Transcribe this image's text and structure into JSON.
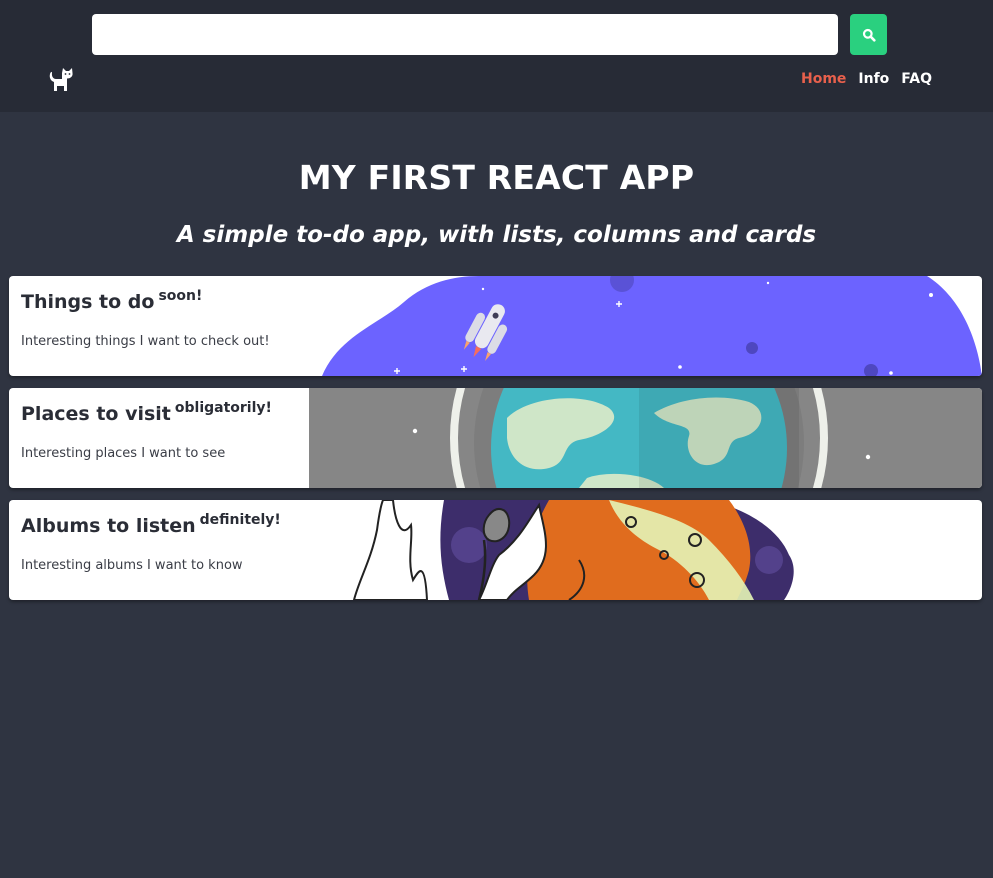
{
  "header": {
    "search": {
      "value": "",
      "placeholder": ""
    },
    "search_button_icon": "search-icon",
    "logo_icon": "cat-icon",
    "nav": [
      {
        "label": "Home",
        "active": true
      },
      {
        "label": "Info",
        "active": false
      },
      {
        "label": "FAQ",
        "active": false
      }
    ]
  },
  "hero": {
    "title": "MY FIRST REACT APP",
    "subtitle": "A simple to-do app, with lists, columns and cards"
  },
  "lists": [
    {
      "title": "Things to do",
      "badge": "soon!",
      "description": "Interesting things I want to check out!",
      "art": "rocket-space-illustration"
    },
    {
      "title": "Places to visit",
      "badge": "obligatorily!",
      "description": "Interesting places I want to see",
      "art": "earth-illustration"
    },
    {
      "title": "Albums to listen",
      "badge": "definitely!",
      "description": "Interesting albums I want to know",
      "art": "album-cover-illustration"
    }
  ],
  "colors": {
    "background": "#2f3441",
    "header": "#272b36",
    "search_button": "#2ad07f",
    "nav_active": "#e8604c",
    "card_text": "#2a2d36"
  }
}
